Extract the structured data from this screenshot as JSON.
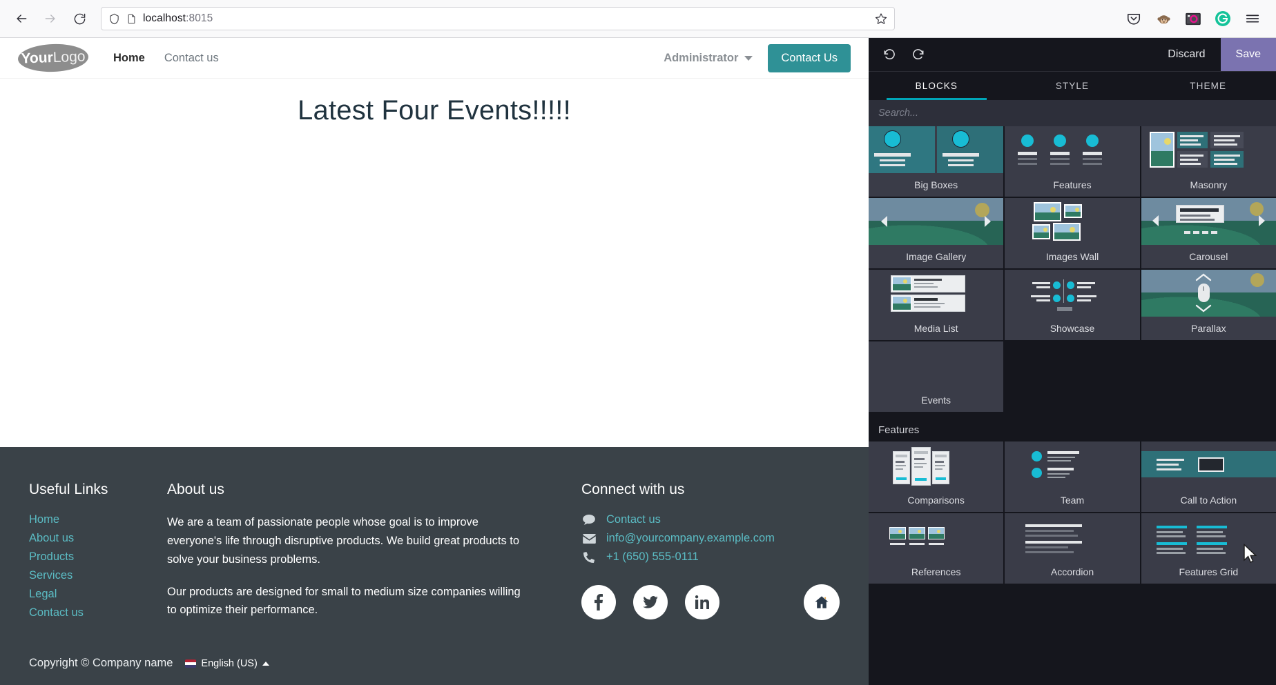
{
  "browser": {
    "url_host": "localhost",
    "url_port": ":8015",
    "back_icon": "back-arrow-icon",
    "forward_icon": "forward-arrow-icon",
    "reload_icon": "reload-icon",
    "shield_icon": "shield-icon",
    "page_icon": "page-icon",
    "bookmark_icon": "star-icon",
    "extensions": [
      "pocket-icon",
      "monkey-extension-icon",
      "screenshot-extension-icon",
      "grammarly-icon"
    ],
    "menu_icon": "hamburger-menu-icon"
  },
  "site": {
    "logo": {
      "bold": "Your",
      "light": "Logo"
    },
    "nav": [
      {
        "label": "Home",
        "active": true
      },
      {
        "label": "Contact us",
        "active": false
      }
    ],
    "user_menu": "Administrator",
    "cta_button": "Contact Us",
    "hero_title": "Latest Four Events!!!!!",
    "accent_color": "#2f9196"
  },
  "footer": {
    "useful_links": {
      "title": "Useful Links",
      "links": [
        "Home",
        "About us",
        "Products",
        "Services",
        "Legal",
        "Contact us"
      ]
    },
    "about": {
      "title": "About us",
      "paragraphs": [
        "We are a team of passionate people whose goal is to improve everyone's life through disruptive products. We build great products to solve your business problems.",
        "Our products are designed for small to medium size companies willing to optimize their performance."
      ]
    },
    "connect": {
      "title": "Connect with us",
      "items": [
        {
          "icon": "comment-icon",
          "label": "Contact us"
        },
        {
          "icon": "envelope-icon",
          "label": "info@yourcompany.example.com"
        },
        {
          "icon": "phone-icon",
          "label": "+1 (650) 555-0111"
        }
      ],
      "socials": [
        "facebook-icon",
        "twitter-icon",
        "linkedin-icon"
      ],
      "home_badge": "home-icon"
    },
    "copyright": "Copyright © Company name",
    "language": "English (US)",
    "link_color": "#5bbcc4",
    "bg_color": "#3a4248"
  },
  "editor": {
    "undo_icon": "undo-icon",
    "redo_icon": "redo-icon",
    "discard_label": "Discard",
    "save_label": "Save",
    "save_color": "#7b73b0",
    "tabs": [
      {
        "label": "BLOCKS",
        "active": true
      },
      {
        "label": "STYLE",
        "active": false
      },
      {
        "label": "THEME",
        "active": false
      }
    ],
    "search_placeholder": "Search...",
    "active_tab_underline_color": "#00a6b8",
    "structure_blocks": [
      {
        "label": "Big Boxes",
        "art": "bigboxes"
      },
      {
        "label": "Features",
        "art": "features"
      },
      {
        "label": "Masonry",
        "art": "masonry"
      },
      {
        "label": "Image Gallery",
        "art": "gallery"
      },
      {
        "label": "Images Wall",
        "art": "imageswall"
      },
      {
        "label": "Carousel",
        "art": "carousel"
      },
      {
        "label": "Media List",
        "art": "medialist"
      },
      {
        "label": "Showcase",
        "art": "showcase"
      },
      {
        "label": "Parallax",
        "art": "parallax"
      },
      {
        "label": "Events",
        "art": "blank"
      }
    ],
    "features_section_title": "Features",
    "features_blocks": [
      {
        "label": "Comparisons",
        "art": "comparisons"
      },
      {
        "label": "Team",
        "art": "team"
      },
      {
        "label": "Call to Action",
        "art": "cta"
      },
      {
        "label": "References",
        "art": "references"
      },
      {
        "label": "Accordion",
        "art": "accordion"
      },
      {
        "label": "Features Grid",
        "art": "featuresgrid"
      }
    ]
  }
}
